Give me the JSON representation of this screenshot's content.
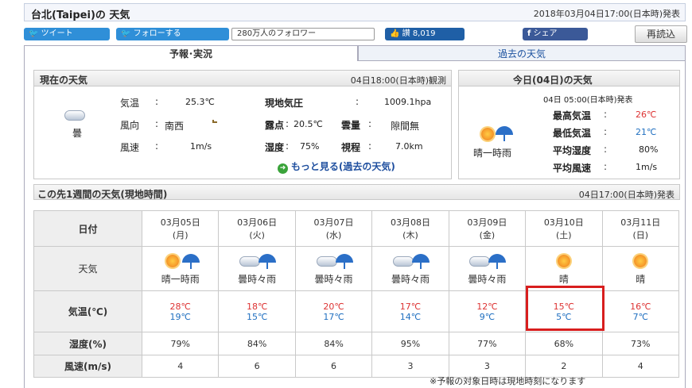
{
  "header": {
    "title": "台北(Taipei)の 天気",
    "issued": "2018年03月04日17:00(日本時)発表"
  },
  "social": {
    "tweet": "ツイート",
    "follow": "フォローする",
    "followers": "280万人のフォロワー",
    "hatena": "8,019",
    "share": "シェア",
    "reload": "再読込"
  },
  "tabs": {
    "forecast": "予報･実況",
    "past": "過去の天気"
  },
  "current": {
    "title": "現在の天気",
    "observed": "04日18:00(日本時)観測",
    "weather": "曇",
    "rows": [
      {
        "l1": "気温",
        "v1": "25.3℃",
        "l2": "現地気圧",
        "v2": "1009.1hpa"
      },
      {
        "l1": "風向",
        "v1": "南西",
        "l2": "露点",
        "v2": "20.5℃",
        "l3": "雲量",
        "v3": "隙間無"
      },
      {
        "l1": "風速",
        "v1": "1m/s",
        "l2": "湿度",
        "v2": "75%",
        "l3": "視程",
        "v3": "7.0km"
      }
    ],
    "more": "もっと見る(過去の天気)"
  },
  "today": {
    "title": "今日(04日)の天気",
    "issued": "04日 05:00(日本時)発表",
    "weather": "晴一時雨",
    "items": [
      {
        "label": "最高気温",
        "value": "26℃"
      },
      {
        "label": "最低気温",
        "value": "21℃"
      },
      {
        "label": "平均湿度",
        "value": "80%"
      },
      {
        "label": "平均風速",
        "value": "1m/s"
      }
    ]
  },
  "week": {
    "title": "この先1週間の天気(現地時間)",
    "issued": "04日17:00(日本時)発表",
    "row_labels": {
      "date": "日付",
      "weather": "天気",
      "temp": "気温(℃)",
      "humidity": "湿度(%)",
      "wind": "風速(m/s)"
    },
    "days": [
      {
        "date": "03月05日",
        "dow": "(月)",
        "weather": "晴一時雨",
        "hi": "28℃",
        "lo": "19℃",
        "hum": "79%",
        "wind": "4"
      },
      {
        "date": "03月06日",
        "dow": "(火)",
        "weather": "曇時々雨",
        "hi": "18℃",
        "lo": "15℃",
        "hum": "84%",
        "wind": "6"
      },
      {
        "date": "03月07日",
        "dow": "(水)",
        "weather": "曇時々雨",
        "hi": "20℃",
        "lo": "17℃",
        "hum": "84%",
        "wind": "6"
      },
      {
        "date": "03月08日",
        "dow": "(木)",
        "weather": "曇時々雨",
        "hi": "17℃",
        "lo": "14℃",
        "hum": "95%",
        "wind": "3"
      },
      {
        "date": "03月09日",
        "dow": "(金)",
        "weather": "曇時々雨",
        "hi": "12℃",
        "lo": "9℃",
        "hum": "77%",
        "wind": "3"
      },
      {
        "date": "03月10日",
        "dow": "(土)",
        "weather": "晴",
        "hi": "15℃",
        "lo": "5℃",
        "hum": "68%",
        "wind": "2"
      },
      {
        "date": "03月11日",
        "dow": "(日)",
        "weather": "晴",
        "hi": "16℃",
        "lo": "7℃",
        "hum": "73%",
        "wind": "4"
      }
    ],
    "note": "※予報の対象日時は現地時刻になります"
  },
  "icons": {
    "sunny": "sun-icon",
    "cloudy": "cloud-icon",
    "rain": "umbrella-icon",
    "more": "arrow-circle-icon",
    "hatena": "thumbs-up-icon",
    "facebook": "facebook-icon",
    "twitter": "twitter-bird-icon"
  }
}
